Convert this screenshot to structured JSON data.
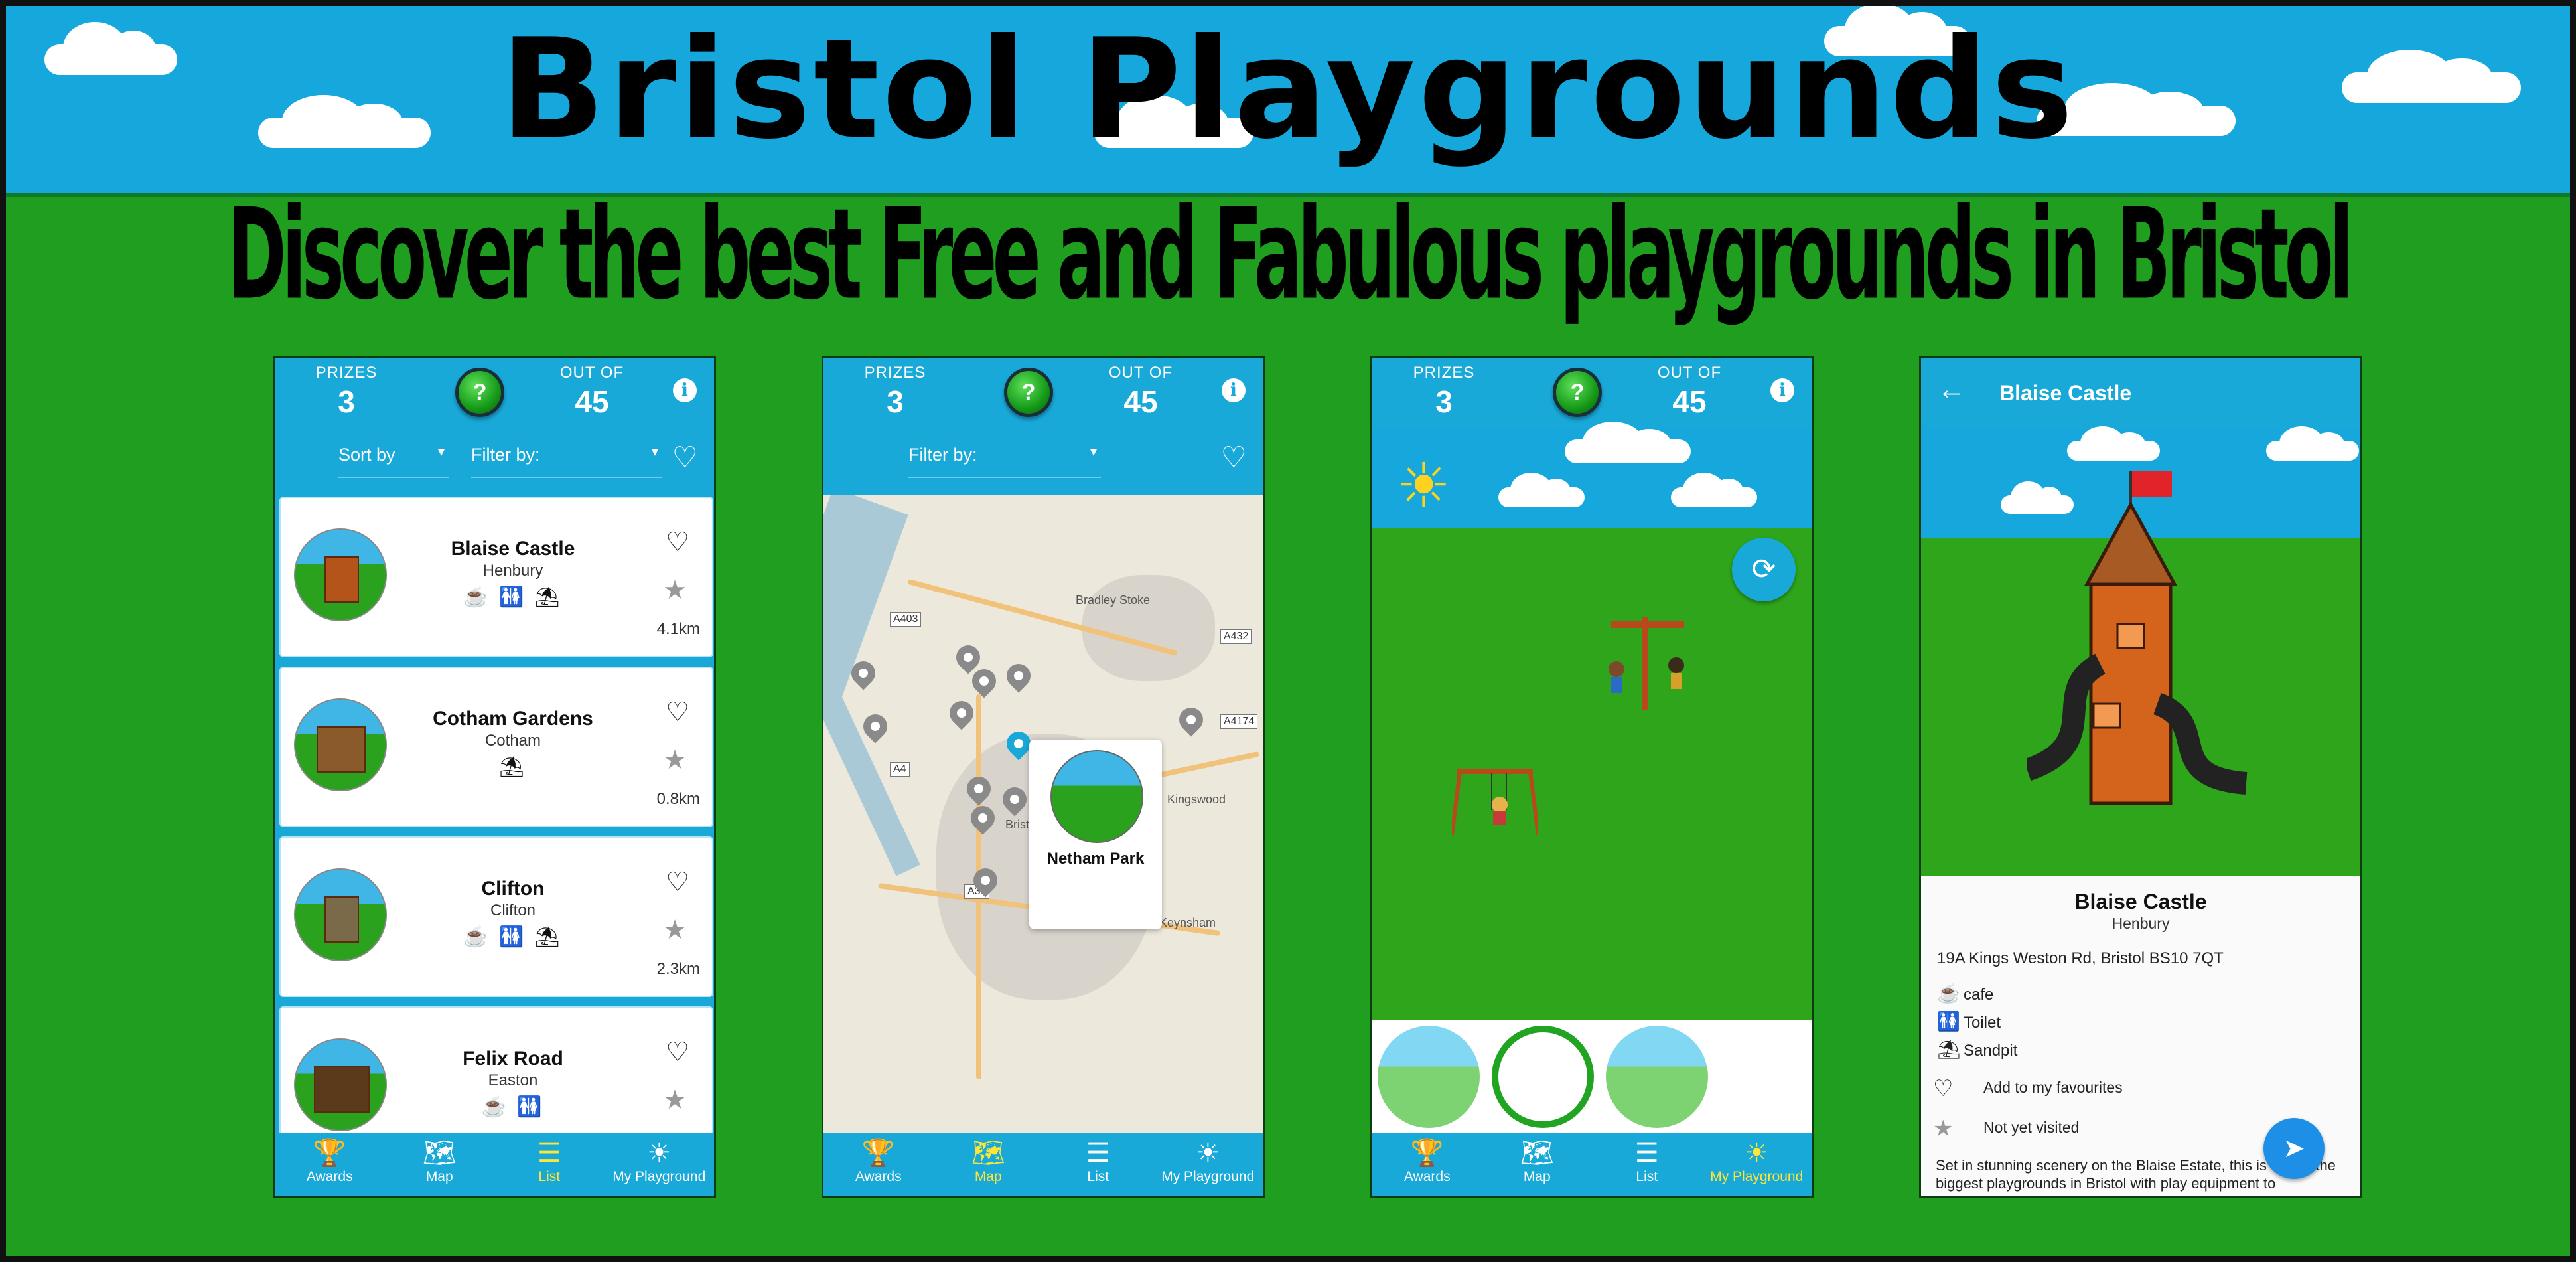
{
  "banner": {
    "title": "Bristol Playgrounds",
    "subtitle": "Discover the best Free and Fabulous playgrounds in Bristol",
    "colors": {
      "sky": "#16a8dc",
      "grass": "#1f9e1f",
      "app_blue": "#19a9d9",
      "active_nav": "#fde53a"
    }
  },
  "stats": {
    "prizes_label": "PRIZES",
    "prizes_value": "3",
    "outof_label": "OUT OF",
    "outof_value": "45",
    "ball_label": "?",
    "info_icon": "info-icon"
  },
  "nav": [
    {
      "label": "Awards",
      "icon": "trophy-icon"
    },
    {
      "label": "Map",
      "icon": "map-icon"
    },
    {
      "label": "List",
      "icon": "list-icon"
    },
    {
      "label": "My Playground",
      "icon": "sun-icon"
    }
  ],
  "list_screen": {
    "sort_label": "Sort by",
    "filter_label": "Filter by:",
    "active_tab": "List",
    "items": [
      {
        "name": "Blaise Castle",
        "area": "Henbury",
        "amenities": "☕ 🚻 ⛱",
        "distance": "4.1km"
      },
      {
        "name": "Cotham Gardens",
        "area": "Cotham",
        "amenities": "⛱",
        "distance": "0.8km"
      },
      {
        "name": "Clifton",
        "area": "Clifton",
        "amenities": "☕ 🚻 ⛱",
        "distance": "2.3km"
      },
      {
        "name": "Felix Road",
        "area": "Easton",
        "amenities": "☕ 🚻",
        "distance": ""
      }
    ]
  },
  "map_screen": {
    "filter_label": "Filter by:",
    "active_tab": "Map",
    "popup_name": "Netham Park",
    "labels": [
      "Kingswood",
      "Keynsham",
      "Bristol",
      "Bradley Stoke"
    ],
    "roads": [
      "A403",
      "A432",
      "A4174",
      "A4",
      "A38"
    ]
  },
  "playground_screen": {
    "active_tab": "My Playground",
    "refresh_icon": "refresh-icon"
  },
  "detail_screen": {
    "header_title": "Blaise Castle",
    "name": "Blaise Castle",
    "area": "Henbury",
    "address": "19A Kings Weston Rd, Bristol BS10 7QT",
    "amenities": [
      {
        "icon": "cafe-icon",
        "label": "cafe"
      },
      {
        "icon": "toilet-icon",
        "label": "Toilet"
      },
      {
        "icon": "sandpit-icon",
        "label": "Sandpit"
      }
    ],
    "favourite_label": "Add to my favourites",
    "visited_label": "Not yet visited",
    "description": "Set in stunning scenery on the Blaise Estate, this is one of the biggest playgrounds in Bristol with play equipment to"
  }
}
